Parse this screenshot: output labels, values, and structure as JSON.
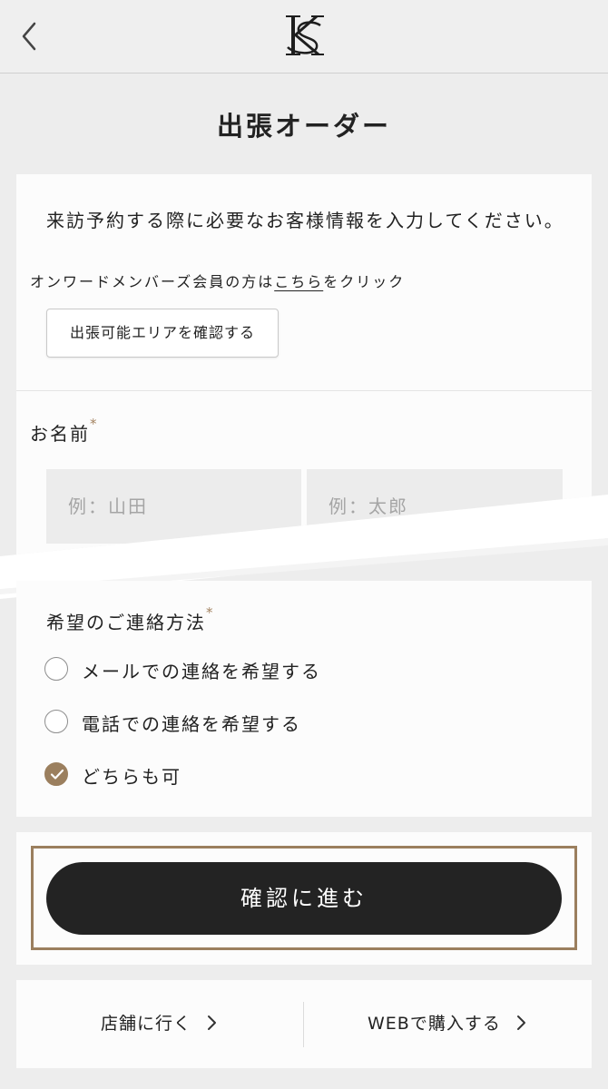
{
  "header": {
    "back": "back-icon",
    "logo": "brand-logo-icon"
  },
  "title": "出張オーダー",
  "intro": {
    "text": "来訪予約する際に必要なお客様情報を入力してください。",
    "member_prefix": "オンワードメンバーズ会員の方は",
    "member_link": "こちら",
    "member_suffix": "をクリック",
    "area_button": "出張可能エリアを確認する"
  },
  "name": {
    "label": "お名前",
    "required": "*",
    "last_placeholder": "例：山田",
    "first_placeholder": "例：太郎"
  },
  "contact": {
    "label": "希望のご連絡方法",
    "required": "*",
    "options": [
      {
        "label": "メールでの連絡を希望する",
        "checked": false
      },
      {
        "label": "電話での連絡を希望する",
        "checked": false
      },
      {
        "label": "どちらも可",
        "checked": true
      }
    ]
  },
  "submit": {
    "label": "確認に進む"
  },
  "links": {
    "store": "店舗に行く",
    "web": "WEBで購入する"
  },
  "colors": {
    "accent": "#9b7f5e",
    "button": "#232323",
    "background": "#ededed"
  }
}
